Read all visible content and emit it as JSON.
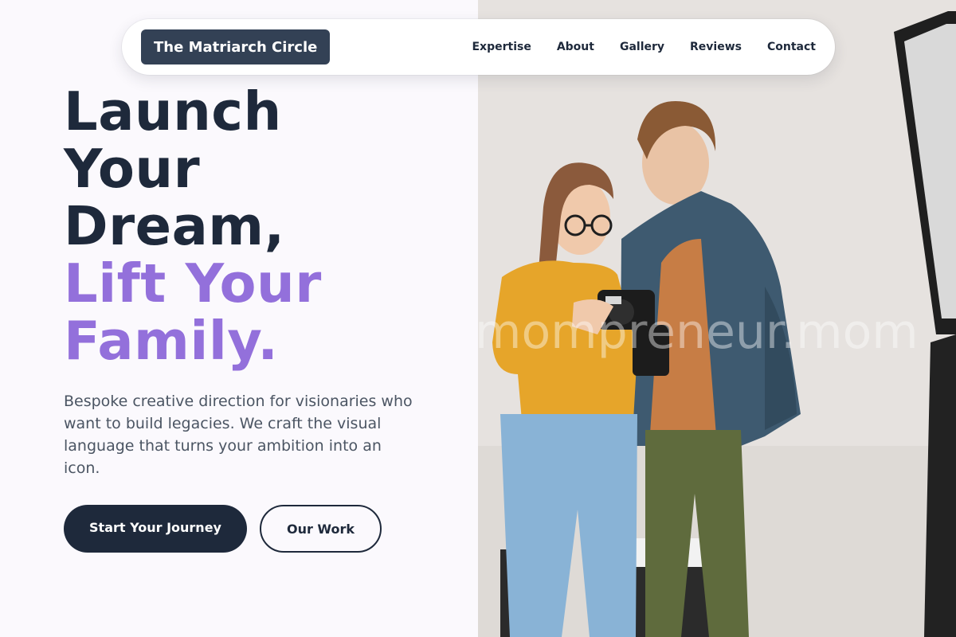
{
  "navbar": {
    "brand": "The Matriarch Circle",
    "links": [
      {
        "label": "Expertise"
      },
      {
        "label": "About"
      },
      {
        "label": "Gallery"
      },
      {
        "label": "Reviews"
      },
      {
        "label": "Contact"
      }
    ]
  },
  "hero": {
    "headline_lines": [
      "Launch",
      "Your",
      "Dream,"
    ],
    "headline_accent_lines": [
      "Lift Your",
      "Family."
    ],
    "description": "Bespoke creative direction for visionaries who want to build legacies. We craft the visual language that turns your ambition into an icon.",
    "primary_cta": "Start Your Journey",
    "secondary_cta": "Our Work"
  },
  "photo": {
    "watermark": "mompreneur.mom"
  },
  "colors": {
    "navy": "#1e293b",
    "accent_purple": "#9370db",
    "brand_pill": "#334155",
    "body_text": "#4b5563",
    "left_bg": "#fbf9fd"
  }
}
